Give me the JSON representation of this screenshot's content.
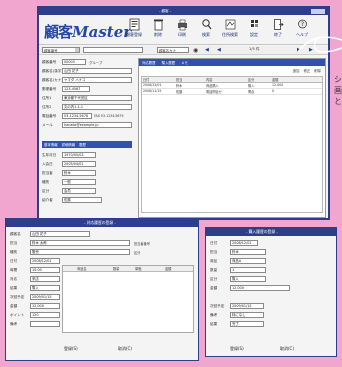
{
  "app": {
    "logo_kanji": "顧客",
    "logo_latin": "Master",
    "brand_tag": "\"顧客\"",
    "title_bar_text": "- 顧客 -"
  },
  "toolbar": {
    "buttons": [
      {
        "label": "顧客登録",
        "icon": "card-icon"
      },
      {
        "label": "削除",
        "icon": "trash-icon"
      },
      {
        "label": "印刷",
        "icon": "printer-icon"
      },
      {
        "label": "検索",
        "icon": "search-icon"
      },
      {
        "label": "住所検索",
        "icon": "map-icon"
      },
      {
        "label": "設定",
        "icon": "settings-icon"
      },
      {
        "label": "終了",
        "icon": "exit-icon"
      },
      {
        "label": "ヘルプ",
        "icon": "help-icon"
      }
    ]
  },
  "nav": {
    "dropdown_left": "顧客番号",
    "dropdown_mid": "顧客名カナ",
    "record_counter": "1/5 件"
  },
  "main_form": {
    "fields": [
      {
        "label": "顧客番号",
        "value": "00003",
        "extra": "グループ"
      },
      {
        "label": "顧客名(漢字)",
        "value": "山田 花子"
      },
      {
        "label": "顧客名(カナ)",
        "value": "ヤマダ ハナコ"
      },
      {
        "label": "郵便番号",
        "value": "123-4567"
      },
      {
        "label": "住所1",
        "value": "東京都千代田区"
      },
      {
        "label": "住所2",
        "value": "丸の内1-1-1"
      },
      {
        "label": "電話番号",
        "value": "03-1234-5678",
        "extra": "FAX 03-1234-5679"
      },
      {
        "label": "メール",
        "value": "hanako@example.jp"
      }
    ],
    "section_tabs": [
      "基本情報",
      "詳細情報",
      "履歴"
    ],
    "detail_fields": [
      {
        "label": "生年月日",
        "value": "1970/05/03"
      },
      {
        "label": "入会日",
        "value": "2005/04/01"
      },
      {
        "label": "担当者",
        "value": "鈴木"
      },
      {
        "label": "種別",
        "value": "一般"
      },
      {
        "label": "区分",
        "value": "会員"
      },
      {
        "label": "紹介者",
        "value": "佐藤"
      }
    ]
  },
  "right_panel": {
    "tabs": [
      "対応履歴",
      "購入履歴",
      "メモ"
    ],
    "header_buttons": [
      "追加",
      "修正",
      "削除"
    ],
    "columns": [
      "日付",
      "担当",
      "内容",
      "区分",
      "金額"
    ],
    "rows": [
      [
        "2008/12/01",
        "鈴木",
        "商品購入",
        "購入",
        "12,000"
      ],
      [
        "2008/11/15",
        "佐藤",
        "電話問合せ",
        "問合",
        "0"
      ]
    ]
  },
  "side_caption": {
    "lines": [
      "シ",
      "画",
      "と"
    ]
  },
  "dialog_left": {
    "title": "- 対応履歴の登録 -",
    "fields": [
      {
        "label": "顧客名",
        "value": "山田 花子"
      },
      {
        "label": "担当",
        "value": "鈴木 太郎",
        "extra": "担当者番号"
      },
      {
        "label": "種別",
        "value": "販売",
        "extra": "区分"
      },
      {
        "label": "日付",
        "value": "2008/12/01"
      },
      {
        "label": "時間",
        "value": "10:00"
      },
      {
        "label": "対応",
        "value": "来店"
      },
      {
        "label": "結果",
        "value": "購入"
      },
      {
        "label": "次回予定",
        "value": "2009/01/15"
      },
      {
        "label": "金額",
        "value": "12,000"
      },
      {
        "label": "ポイント",
        "value": "120"
      },
      {
        "label": "備考",
        "value": ""
      }
    ],
    "table_headers": [
      "商品名",
      "数量",
      "単価",
      "金額"
    ],
    "buttons": [
      "登録(S)",
      "取消(C)"
    ]
  },
  "dialog_right": {
    "title": "- 購入履歴の登録 -",
    "fields": [
      {
        "label": "日付",
        "value": "2008/12/01"
      },
      {
        "label": "担当",
        "value": "鈴木"
      },
      {
        "label": "商品",
        "value": "商品A"
      },
      {
        "label": "数量",
        "value": "1"
      },
      {
        "label": "区分",
        "value": "購入"
      },
      {
        "label": "金額",
        "value": "12,000"
      }
    ],
    "lower_fields": [
      {
        "label": "次回予定",
        "value": "2009/01/15"
      },
      {
        "label": "備考",
        "value": "特になし"
      },
      {
        "label": "結果",
        "value": "完了"
      }
    ],
    "buttons": [
      "登録(S)",
      "取消(C)"
    ]
  },
  "colors": {
    "background": "#f1a6cf",
    "title_bar": "#2d3f8c",
    "toolbar": "#f3f3f3",
    "window_bg": "#f4f4f4",
    "tab_active": "#3350b0"
  }
}
